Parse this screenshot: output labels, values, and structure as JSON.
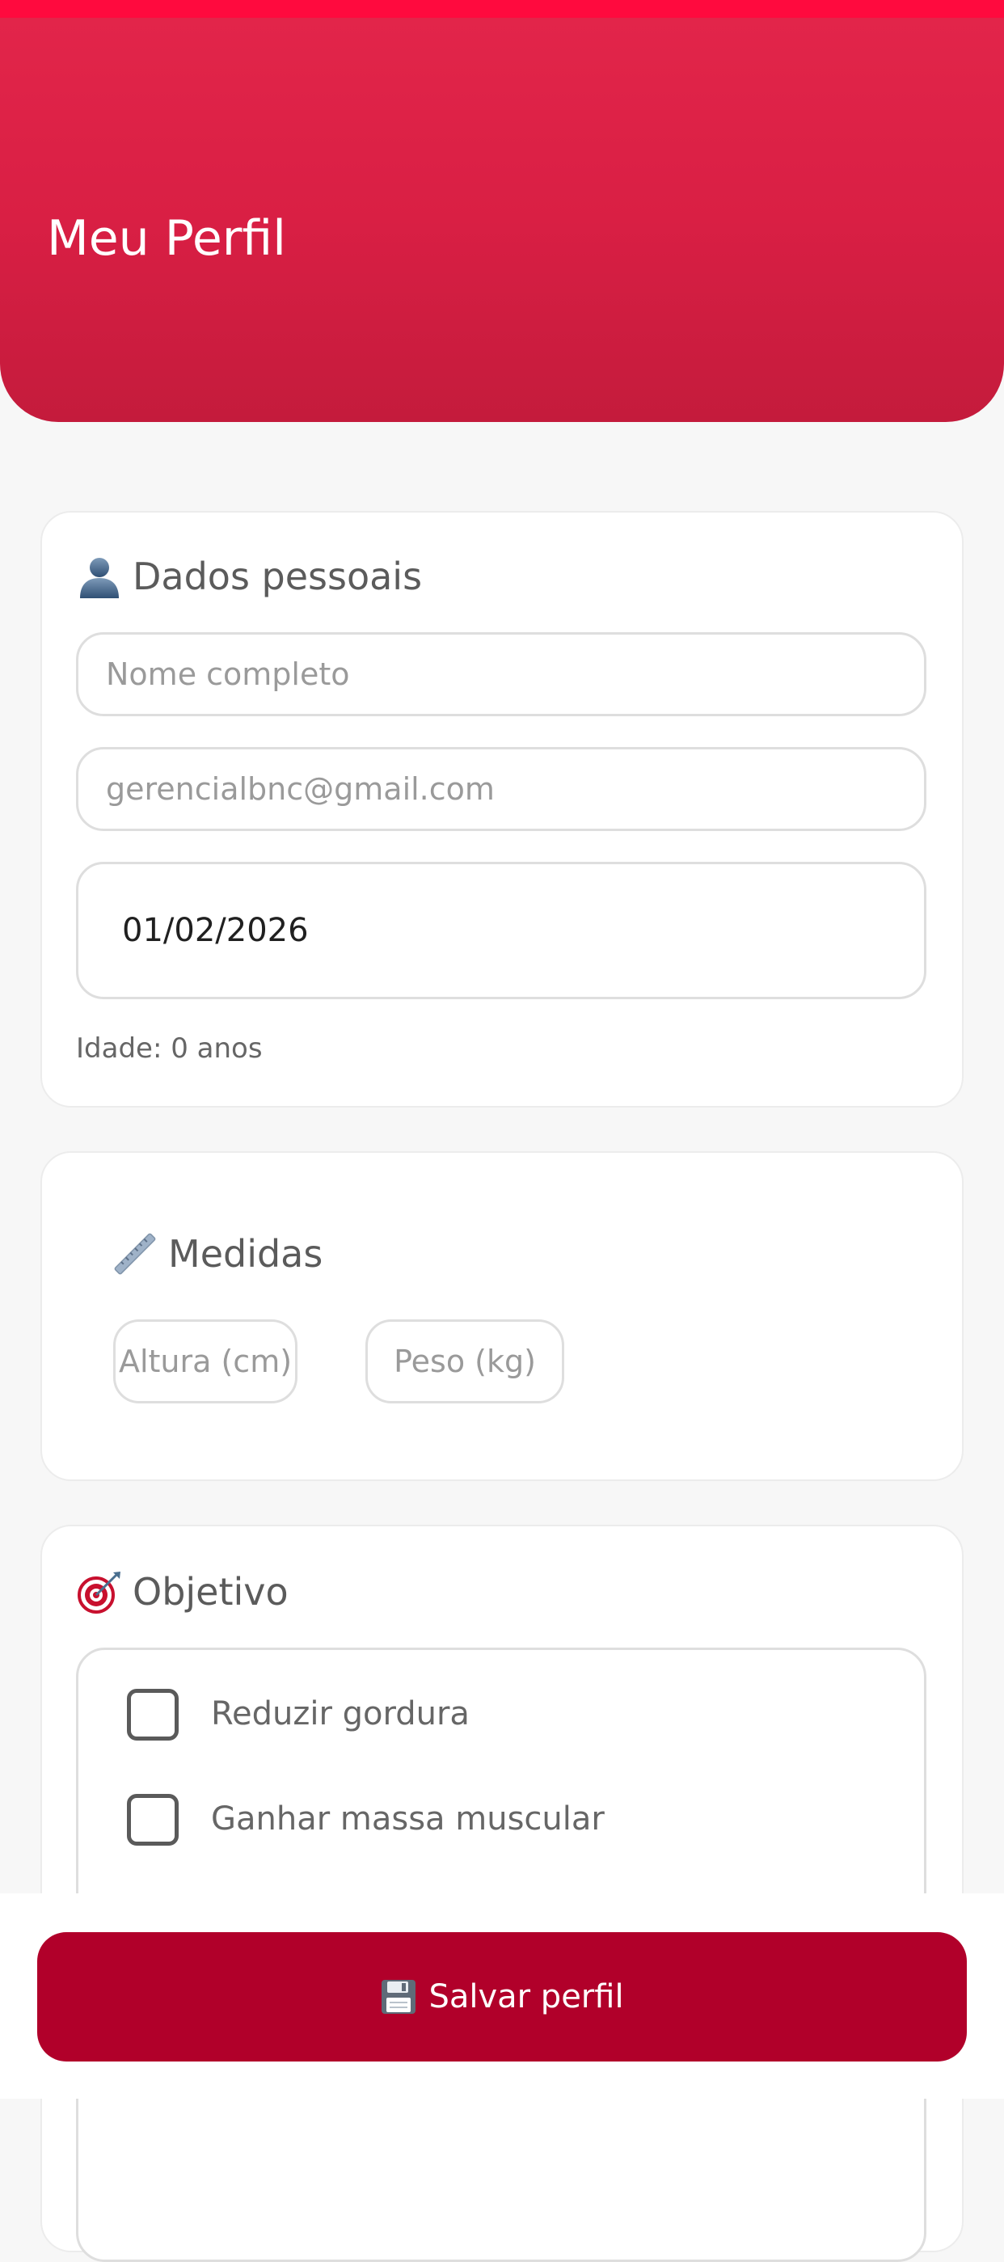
{
  "colors": {
    "header_gradient_top": "#e2254a",
    "header_gradient_bottom": "#c41b3c",
    "save_button": "#b1002a",
    "status_strip": "#ff0a3e"
  },
  "header": {
    "title": "Meu Perfil"
  },
  "personal": {
    "section_icon": "person-icon",
    "title": "Dados pessoais",
    "name_placeholder": "Nome completo",
    "email_placeholder": "gerencialbnc@gmail.com",
    "birthdate_value": "01/02/2026",
    "age_text": "Idade: 0 anos"
  },
  "measures": {
    "section_icon": "ruler-icon",
    "title": "Medidas",
    "height_placeholder": "Altura (cm)",
    "weight_placeholder": "Peso (kg)"
  },
  "goal": {
    "section_icon": "target-icon",
    "title": "Objetivo",
    "options": [
      {
        "label": "Reduzir gordura",
        "checked": false
      },
      {
        "label": "Ganhar massa muscular",
        "checked": false
      }
    ]
  },
  "footer": {
    "save_icon": "floppy-disk-icon",
    "save_label": "Salvar perfil"
  }
}
